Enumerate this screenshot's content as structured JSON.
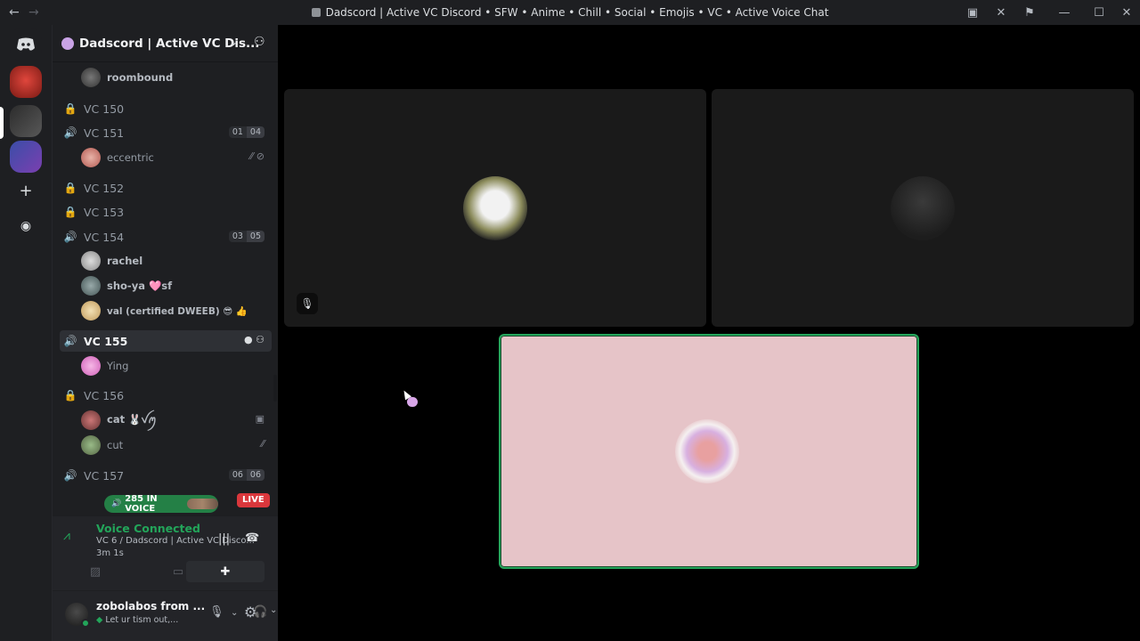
{
  "window": {
    "title": "Dadscord | Active VC Discord • SFW • Anime • Chill • Social • Emojis • VC • Active Voice Chat",
    "back_icon": "arrow-left-icon",
    "forward_icon": "arrow-right-icon",
    "icons": [
      "inbox-icon",
      "tools-icon",
      "bug-icon",
      "minimize-icon",
      "maximize-icon",
      "close-icon"
    ],
    "glyphs": {
      "inbox": "▣",
      "tools": "✕",
      "bug": "⚑",
      "min": "—",
      "max": "☐",
      "close": "✕"
    }
  },
  "rail": {
    "add_glyph": "+",
    "discover_glyph": "◉"
  },
  "server": {
    "name": "Dadscord | Active VC Dis...",
    "chevron": "⌄",
    "invite_glyph": "⚇"
  },
  "channels": {
    "above_member": "roombound",
    "vc150": {
      "name": "VC 150"
    },
    "vc151": {
      "name": "VC 151",
      "count": "01",
      "limit": "04",
      "members": [
        {
          "name": "eccentric",
          "icons": "⁄⁄ ⊘"
        }
      ]
    },
    "vc152": {
      "name": "VC 152"
    },
    "vc153": {
      "name": "VC 153"
    },
    "vc154": {
      "name": "VC 154",
      "count": "03",
      "limit": "05",
      "members": [
        {
          "name": "rachel"
        },
        {
          "name": "sho-ya 🩷sf"
        },
        {
          "name": "val (certified DWEEB) 😎 👍"
        }
      ]
    },
    "vc155": {
      "name": "VC 155",
      "icons": "● ⚇",
      "members": [
        {
          "name": "Ying"
        }
      ]
    },
    "vc156": {
      "name": "VC 156",
      "members": [
        {
          "name": "cat 🐰ꪜꪑ",
          "icon": "▣"
        },
        {
          "name": "cut",
          "icon": "⁄⁄"
        }
      ]
    },
    "vc157": {
      "name": "VC 157",
      "count": "06",
      "limit": "06"
    }
  },
  "in_voice": {
    "label": "285 IN VOICE",
    "icon": "🔊"
  },
  "live": "LIVE",
  "voice_panel": {
    "status": "Voice Connected",
    "channel": "VC 6 / Dadscord | Active VC Disco...",
    "elapsed": "3m 1s",
    "glyphs": {
      "signal": "⩘",
      "noise": "|||",
      "hangup": "☎",
      "video": "▨",
      "screen": "▭",
      "activity": "✚"
    }
  },
  "user_panel": {
    "username": "zobolabos from ...",
    "status": "Let ur tism out,...",
    "glyphs": {
      "mic": "🎙",
      "headphones": "🎧",
      "settings": "⚙",
      "chevron": "⌄"
    }
  },
  "stage": {
    "tile1_badge": "🎙"
  },
  "colors": {
    "voice_green": "#23a55a",
    "live_red": "#da373c",
    "speaking_tile_bg": "#e6c4c8"
  }
}
